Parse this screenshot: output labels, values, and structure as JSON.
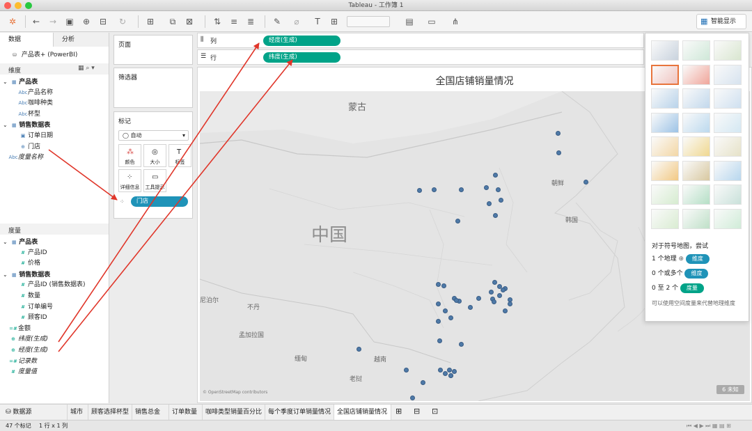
{
  "window": {
    "title": "Tableau - 工作簿 1"
  },
  "toolbar": {
    "show_me_label": "智能显示"
  },
  "data_pane": {
    "tabs": [
      "数据",
      "分析"
    ],
    "datasource": "产品表+ (PowerBI)",
    "dimensions_label": "维度",
    "dimensions": [
      {
        "label": "产品表",
        "icon": "table-icon",
        "bold": true
      },
      {
        "label": "产品名称",
        "icon": "abc-icon"
      },
      {
        "label": "咖啡种类",
        "icon": "abc-icon"
      },
      {
        "label": "杯型",
        "icon": "abc-icon"
      },
      {
        "label": "销售数据表",
        "icon": "table-icon",
        "bold": true
      },
      {
        "label": "订单日期",
        "icon": "calendar-icon"
      },
      {
        "label": "门店",
        "icon": "globe-icon"
      },
      {
        "label": "度量名称",
        "icon": "abc-icon",
        "italic": true
      }
    ],
    "measures_label": "度量",
    "measures": [
      {
        "label": "产品表",
        "icon": "table-icon",
        "bold": true
      },
      {
        "label": "产品ID",
        "icon": "number-icon"
      },
      {
        "label": "价格",
        "icon": "number-icon"
      },
      {
        "label": "销售数据表",
        "icon": "table-icon",
        "bold": true
      },
      {
        "label": "产品ID (销售数据表)",
        "icon": "number-icon"
      },
      {
        "label": "数量",
        "icon": "number-icon"
      },
      {
        "label": "订单编号",
        "icon": "number-icon"
      },
      {
        "label": "顾客ID",
        "icon": "number-icon"
      },
      {
        "label": "金额",
        "icon": "calc-icon"
      },
      {
        "label": "纬度(生成)",
        "icon": "globe-icon",
        "italic": true
      },
      {
        "label": "经度(生成)",
        "icon": "globe-icon",
        "italic": true
      },
      {
        "label": "记录数",
        "icon": "calc-icon",
        "italic": true
      },
      {
        "label": "度量值",
        "icon": "number-icon",
        "italic": true
      }
    ]
  },
  "cards": {
    "pages": "页面",
    "filters": "筛选器",
    "marks": "标记",
    "mark_type": "自动",
    "mark_buttons": [
      "颜色",
      "大小",
      "标签",
      "详细信息",
      "工具提示"
    ],
    "detail_pill": "门店"
  },
  "shelves": {
    "columns_label": "列",
    "rows_label": "行",
    "columns_pill": "经度(生成)",
    "rows_pill": "纬度(生成)"
  },
  "view": {
    "title": "全国店铺销量情况",
    "map_labels": [
      "蒙古",
      "中国",
      "朝鲜",
      "韩国",
      "不丹",
      "孟加拉国",
      "缅甸",
      "老挝",
      "越南",
      "尼泊尔"
    ],
    "attribution": "© OpenStreetMap contributors",
    "unknown_badge": "6 未知"
  },
  "show_me": {
    "hint_title": "对于符号地图，尝试",
    "hint_lines": [
      {
        "prefix": "1 个地理",
        "pill": "维度",
        "color": "#1f93b8"
      },
      {
        "prefix": "0 个或多个",
        "pill": "维度",
        "color": "#1f93b8"
      },
      {
        "prefix": "0 至 2 个",
        "pill": "度量",
        "color": "#00a388"
      }
    ],
    "note": "可以使用空间度量来代替地理维度"
  },
  "sheet_tabs": [
    "数据源",
    "城市",
    "顾客选择杯型",
    "销售总金额",
    "订单数量",
    "咖啡类型销量百分比",
    "每个季度订单销量情况",
    "全国店铺销量情况"
  ],
  "active_sheet": "全国店铺销量情况",
  "status": {
    "marks": "47 个标记",
    "rows_cols": "1 行 x 1 列"
  },
  "colors": {
    "dimension_pill": "#1f93b8",
    "measure_pill": "#00a388",
    "dot": "#4e79a7",
    "arrow": "#e0362a"
  }
}
